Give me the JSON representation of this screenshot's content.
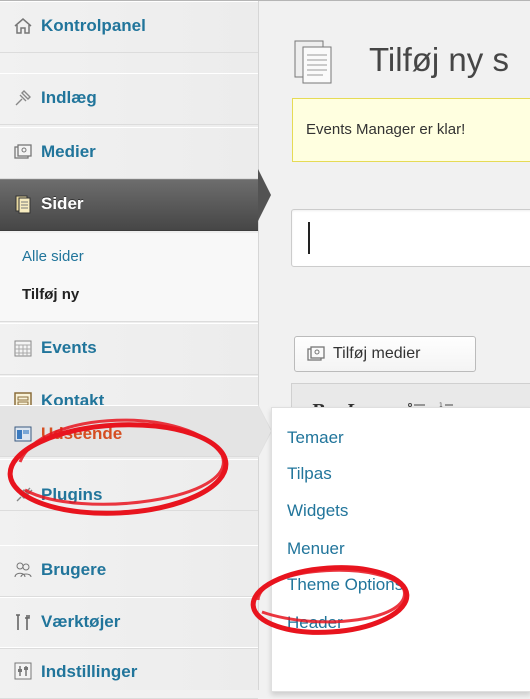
{
  "sidebar": {
    "items": [
      {
        "label": "Kontrolpanel",
        "icon": "dashboard-icon"
      },
      {
        "label": "Indlæg",
        "icon": "pin-icon"
      },
      {
        "label": "Medier",
        "icon": "media-icon"
      },
      {
        "label": "Sider",
        "icon": "pages-icon"
      },
      {
        "label": "Events",
        "icon": "calendar-icon"
      },
      {
        "label": "Kontakt",
        "icon": "contact-form-icon"
      },
      {
        "label": "Udseende",
        "icon": "appearance-icon"
      },
      {
        "label": "Plugins",
        "icon": "plugin-icon"
      },
      {
        "label": "Brugere",
        "icon": "users-icon"
      },
      {
        "label": "Værktøjer",
        "icon": "tools-icon"
      },
      {
        "label": "Indstillinger",
        "icon": "settings-icon"
      }
    ],
    "pages_submenu": {
      "all_pages": "Alle sider",
      "add_new": "Tilføj ny"
    }
  },
  "appearance_flyout": {
    "items": [
      "Temaer",
      "Tilpas",
      "Widgets",
      "Menuer",
      "Theme Options",
      "Header"
    ]
  },
  "main": {
    "page_title": "Tilføj ny s",
    "notice": "Events Manager er klar!",
    "add_media_label": "Tilføj medier",
    "toolbar": {
      "bold": "B",
      "italic": "I",
      "strikethrough": "ABC"
    }
  },
  "colors": {
    "link": "#21759b",
    "hover_link": "#d54e21",
    "current_menu": "#4d4d4d",
    "notice_bg": "#ffffe0",
    "annotation": "#e8141e"
  }
}
